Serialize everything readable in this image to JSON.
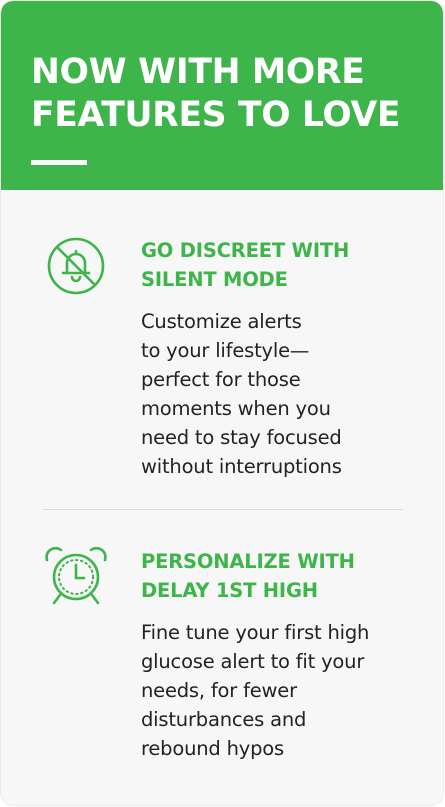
{
  "header": {
    "title_lines": [
      "NOW WITH MORE",
      "FEATURES TO LOVE"
    ]
  },
  "features": [
    {
      "icon": "bell-off-icon",
      "title_lines": [
        "GO DISCREET WITH",
        "SILENT MODE"
      ],
      "desc_lines": [
        "Customize alerts",
        "to your lifestyle—",
        "perfect for those",
        "moments when you",
        "need to stay focused",
        "without interruptions"
      ]
    },
    {
      "icon": "alarm-clock-icon",
      "title_lines": [
        "PERSONALIZE WITH",
        "DELAY 1ST HIGH"
      ],
      "desc_lines": [
        "Fine tune your first high",
        "glucose alert to fit your",
        "needs, for fewer",
        "disturbances and",
        "rebound hypos"
      ]
    }
  ],
  "colors": {
    "brand_green": "#3db54a",
    "text_dark": "#222222",
    "card_background": "#f7f7f7",
    "divider": "#d9d9d9"
  }
}
